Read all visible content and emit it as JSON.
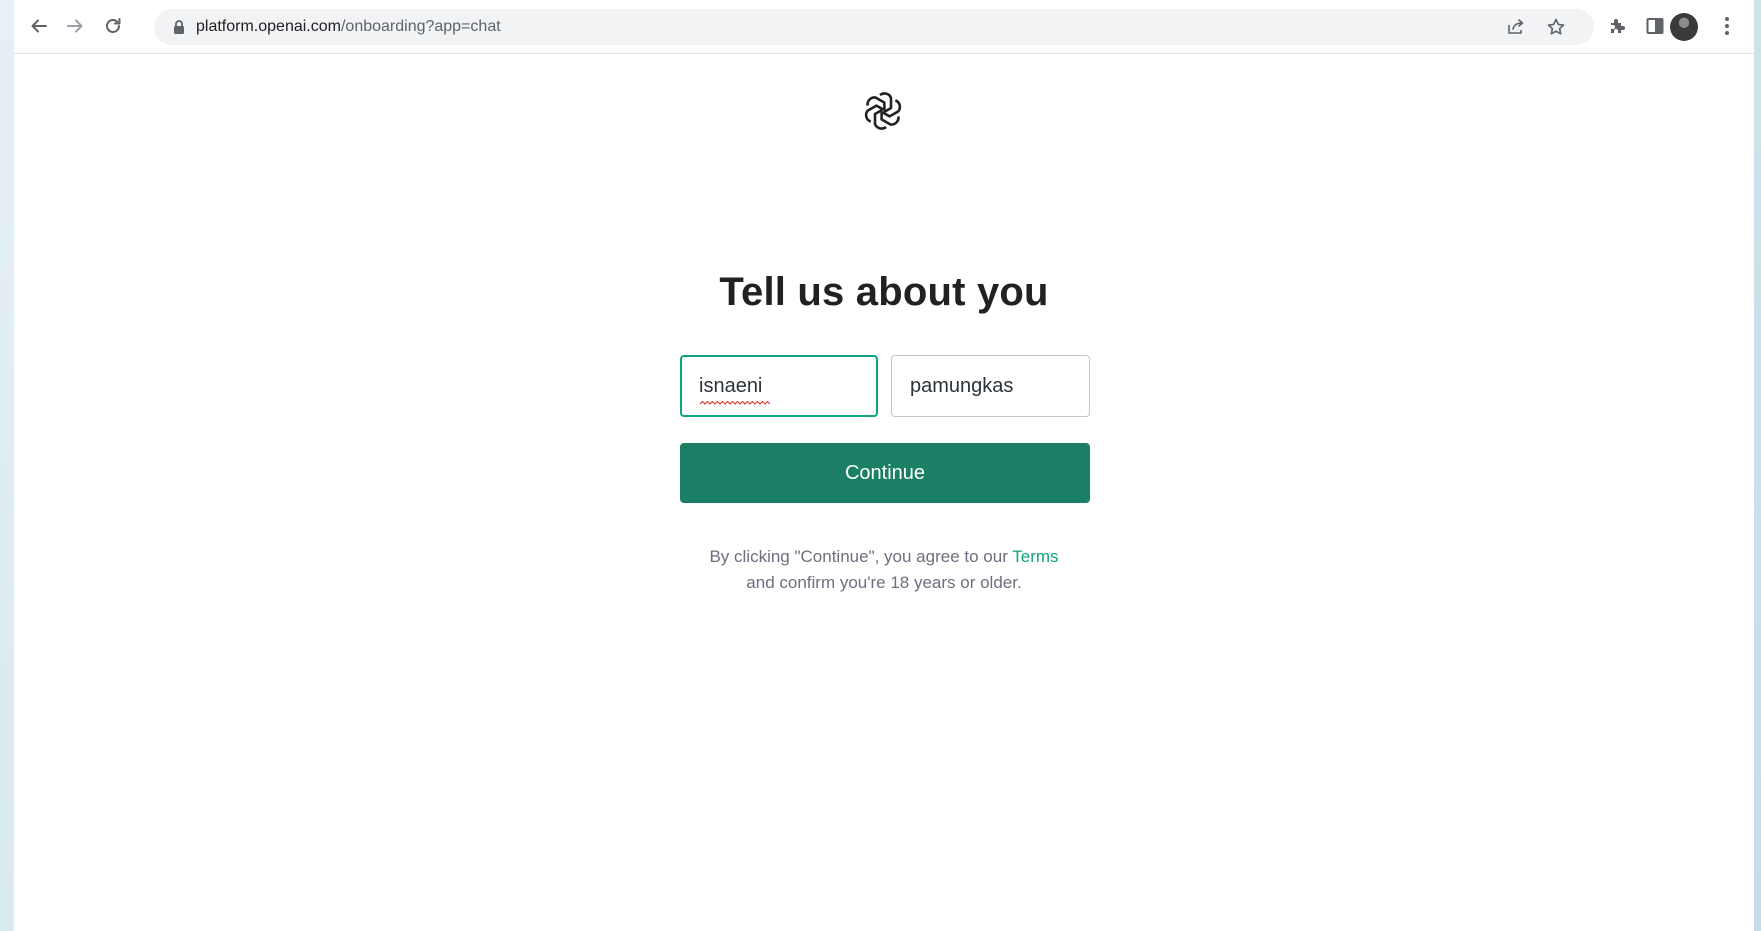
{
  "browser": {
    "url_host": "platform.openai.com",
    "url_path": "/onboarding?app=chat",
    "icons": {
      "back": "back-arrow-icon",
      "forward": "forward-arrow-icon",
      "reload": "reload-icon",
      "lock": "lock-icon",
      "share": "share-icon",
      "bookmark": "star-icon",
      "extensions": "puzzle-icon",
      "side_panel": "side-panel-icon",
      "profile": "avatar",
      "menu": "kebab-menu-icon"
    }
  },
  "page": {
    "title": "Tell us about you",
    "first_name_value": "isnaeni",
    "last_name_value": "pamungkas",
    "continue_label": "Continue",
    "legal_prefix": "By clicking \"Continue\", you agree to our ",
    "terms_link": "Terms",
    "legal_line2": "and confirm you're 18 years or older."
  },
  "colors": {
    "accent": "#10a37f",
    "button": "#1a7f64",
    "heading": "#202123",
    "muted": "#6e6e80"
  }
}
